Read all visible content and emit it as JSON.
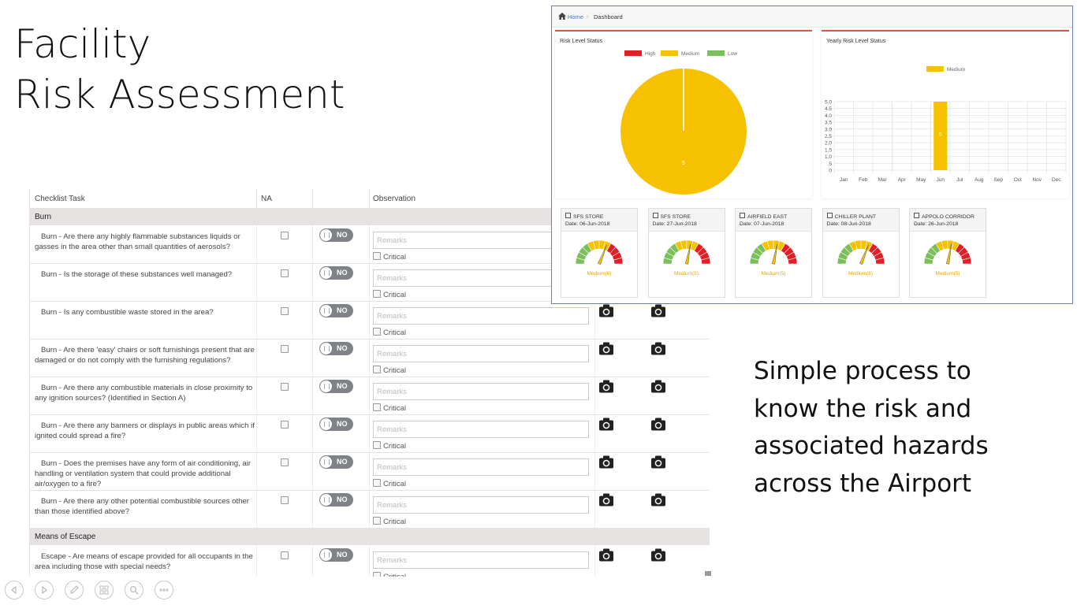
{
  "slide": {
    "title_lines": [
      "Facility",
      "Risk Assessment"
    ],
    "tagline_lines": [
      "Simple process to",
      "know the risk and",
      "associated hazards",
      "across the Airport"
    ]
  },
  "checklist": {
    "columns": {
      "task": "Checklist Task",
      "na": "NA",
      "observation": "Observation"
    },
    "remarks_placeholder": "Remarks",
    "critical_label": "Critical",
    "toggle_label": "NO",
    "sections": [
      {
        "name": "Burn",
        "rows": [
          {
            "question": "Burn - Are there any highly flammable substances liquids or gasses in the area other than small quantities of aerosols?"
          },
          {
            "question": "Burn - Is the storage of these substances well managed?"
          },
          {
            "question": "Burn - Is any combustible waste stored in the area?"
          },
          {
            "question": "Burn - Are there 'easy' chairs or soft furnishings present that are damaged or do not comply with the furnishing regulations?"
          },
          {
            "question": "Burn - Are there any combustible materials in close proximity to any ignition sources? (Identified in Section A)"
          },
          {
            "question": "Burn - Are there any banners or displays in public areas which if ignited could spread a fire?"
          },
          {
            "question": "Burn - Does the premises have any form of air conditioning, air handling or ventilation system that could provide additional air/oxygen to a fire?"
          },
          {
            "question": "Burn - Are there any other potential combustible sources other than those identified above?"
          }
        ]
      },
      {
        "name": "Means of Escape",
        "rows": [
          {
            "question": "Escape - Are means of escape provided for all occupants in the area including those with special needs?"
          }
        ]
      }
    ]
  },
  "dashboard": {
    "breadcrumb": {
      "home": "Home",
      "current": "Dashboard"
    },
    "risk_panel_title": "Risk Level Status",
    "yearly_panel_title": "Yearly Risk Level Status",
    "legend": {
      "high": "High",
      "medium": "Medium",
      "low": "Low"
    },
    "colors": {
      "high": "#e41e26",
      "medium": "#f5c100",
      "low": "#7bbf5b",
      "accent": "#d7583b",
      "gauge_label": "#e0a800"
    },
    "cards": [
      {
        "name": "SFS STORE",
        "date": "Date: 06-Jun-2018",
        "level": "Medium(6)",
        "needle": 0.62
      },
      {
        "name": "SFS STORE",
        "date": "Date: 27-Jun-2018",
        "level": "Medium(5)",
        "needle": 0.56
      },
      {
        "name": "AIRFIELD EAST",
        "date": "Date: 07-Jun-2018",
        "level": "Medium(5)",
        "needle": 0.56
      },
      {
        "name": "CHILLER PLANT",
        "date": "Date: 08-Jun-2018",
        "level": "Medium(6)",
        "needle": 0.62
      },
      {
        "name": "APPOLO CORRIDOR",
        "date": "Date: 26-Jun-2018",
        "level": "Medium(5)",
        "needle": 0.56
      }
    ]
  },
  "chart_data": [
    {
      "type": "pie",
      "title": "Risk Level Status",
      "categories": [
        "High",
        "Medium",
        "Low"
      ],
      "values": [
        0,
        5,
        0
      ],
      "data_labels": [
        "5"
      ],
      "legend_position": "top"
    },
    {
      "type": "bar",
      "title": "Yearly Risk Level Status",
      "categories": [
        "Jan",
        "Feb",
        "Mar",
        "Apr",
        "May",
        "Jun",
        "Jul",
        "Aug",
        "Sep",
        "Oct",
        "Nov",
        "Dec"
      ],
      "series": [
        {
          "name": "Medium",
          "values": [
            0,
            0,
            0,
            0,
            0,
            5,
            0,
            0,
            0,
            0,
            0,
            0
          ]
        }
      ],
      "ylim": [
        0,
        5
      ],
      "yticks": [
        "0",
        ".5",
        "1.0",
        "1.5",
        "2.0",
        "2.5",
        "3.0",
        "3.5",
        "4.0",
        "4.5",
        "5.0"
      ],
      "data_labels": [
        "5"
      ],
      "grid": true,
      "legend_position": "top"
    }
  ]
}
